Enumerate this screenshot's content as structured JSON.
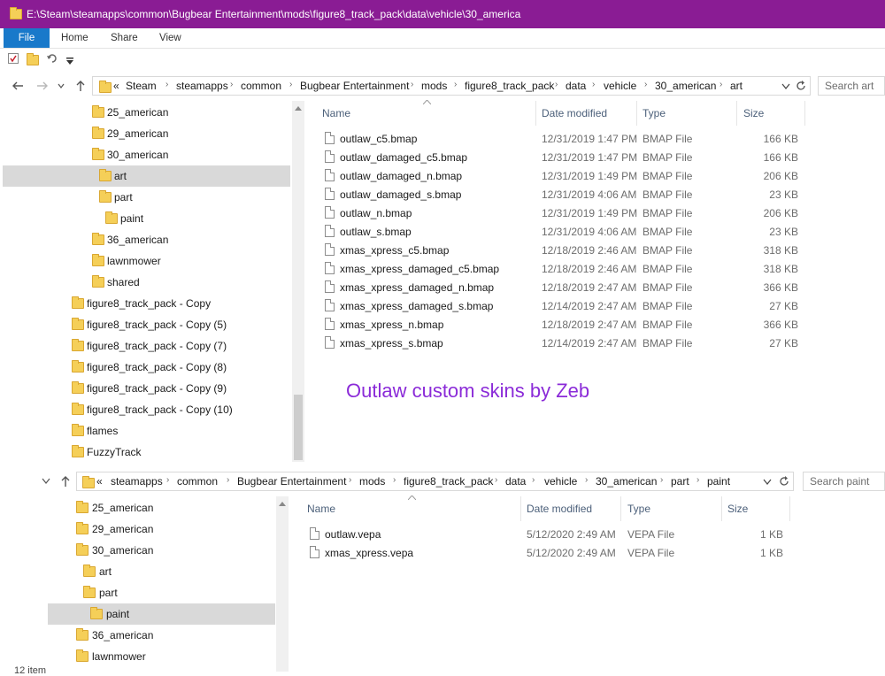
{
  "window": {
    "title": "E:\\Steam\\steamapps\\common\\Bugbear Entertainment\\mods\\figure8_track_pack\\data\\vehicle\\30_america"
  },
  "ribbon": {
    "tabs": [
      "File",
      "Home",
      "Share",
      "View"
    ]
  },
  "top": {
    "breadcrumbs": [
      "«",
      "Steam",
      "steamapps",
      "common",
      "Bugbear Entertainment",
      "mods",
      "figure8_track_pack",
      "data",
      "vehicle",
      "30_american",
      "art"
    ],
    "search_placeholder": "Search art",
    "nav_items": [
      "25_american",
      "29_american",
      "30_american",
      "art",
      "part",
      "paint",
      "36_american",
      "lawnmower",
      "shared",
      "figure8_track_pack - Copy",
      "figure8_track_pack - Copy (5)",
      "figure8_track_pack - Copy (7)",
      "figure8_track_pack - Copy (8)",
      "figure8_track_pack - Copy (9)",
      "figure8_track_pack - Copy (10)",
      "flames",
      "FuzzyTrack"
    ],
    "columns": [
      "Name",
      "Date modified",
      "Type",
      "Size"
    ],
    "files": [
      {
        "name": "outlaw_c5.bmap",
        "date": "12/31/2019 1:47 PM",
        "type": "BMAP File",
        "size": "166 KB"
      },
      {
        "name": "outlaw_damaged_c5.bmap",
        "date": "12/31/2019 1:47 PM",
        "type": "BMAP File",
        "size": "166 KB"
      },
      {
        "name": "outlaw_damaged_n.bmap",
        "date": "12/31/2019 1:49 PM",
        "type": "BMAP File",
        "size": "206 KB"
      },
      {
        "name": "outlaw_damaged_s.bmap",
        "date": "12/31/2019 4:06 AM",
        "type": "BMAP File",
        "size": "23 KB"
      },
      {
        "name": "outlaw_n.bmap",
        "date": "12/31/2019 1:49 PM",
        "type": "BMAP File",
        "size": "206 KB"
      },
      {
        "name": "outlaw_s.bmap",
        "date": "12/31/2019 4:06 AM",
        "type": "BMAP File",
        "size": "23 KB"
      },
      {
        "name": "xmas_xpress_c5.bmap",
        "date": "12/18/2019 2:46 AM",
        "type": "BMAP File",
        "size": "318 KB"
      },
      {
        "name": "xmas_xpress_damaged_c5.bmap",
        "date": "12/18/2019 2:46 AM",
        "type": "BMAP File",
        "size": "318 KB"
      },
      {
        "name": "xmas_xpress_damaged_n.bmap",
        "date": "12/18/2019 2:47 AM",
        "type": "BMAP File",
        "size": "366 KB"
      },
      {
        "name": "xmas_xpress_damaged_s.bmap",
        "date": "12/14/2019 2:47 AM",
        "type": "BMAP File",
        "size": "27 KB"
      },
      {
        "name": "xmas_xpress_n.bmap",
        "date": "12/18/2019 2:47 AM",
        "type": "BMAP File",
        "size": "366 KB"
      },
      {
        "name": "xmas_xpress_s.bmap",
        "date": "12/14/2019 2:47 AM",
        "type": "BMAP File",
        "size": "27 KB"
      }
    ]
  },
  "caption": "Outlaw custom skins by Zeb",
  "bottom": {
    "breadcrumbs": [
      "«",
      "steamapps",
      "common",
      "Bugbear Entertainment",
      "mods",
      "figure8_track_pack",
      "data",
      "vehicle",
      "30_american",
      "part",
      "paint"
    ],
    "search_placeholder": "Search paint",
    "nav_items": [
      "25_american",
      "29_american",
      "30_american",
      "art",
      "part",
      "paint",
      "36_american",
      "lawnmower"
    ],
    "columns": [
      "Name",
      "Date modified",
      "Type",
      "Size"
    ],
    "files": [
      {
        "name": "outlaw.vepa",
        "date": "5/12/2020 2:49 AM",
        "type": "VEPA File",
        "size": "1 KB"
      },
      {
        "name": "xmas_xpress.vepa",
        "date": "5/12/2020 2:49 AM",
        "type": "VEPA File",
        "size": "1 KB"
      }
    ],
    "status": "12 item"
  },
  "colors": {
    "titlebar": "#8a1c94",
    "file_tab": "#1979ca",
    "caption": "#8b2bd8",
    "folder": "#f5cf58",
    "selection": "#d9d9d9"
  },
  "icons": [
    "folder-icon",
    "back-arrow-icon",
    "forward-arrow-icon",
    "up-arrow-icon",
    "refresh-icon",
    "file-icon",
    "chevron-down-icon",
    "sort-caret-icon"
  ]
}
